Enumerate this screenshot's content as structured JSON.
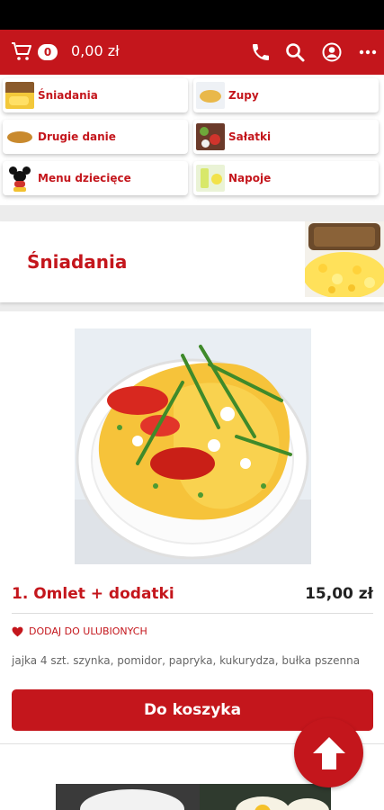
{
  "header": {
    "cart_count": "0",
    "cart_total": "0,00 zł",
    "icons": [
      "cart-icon",
      "phone-icon",
      "search-icon",
      "account-icon",
      "more-icon"
    ]
  },
  "categories": [
    {
      "label": "Śniadania",
      "icon": "breakfast-thumb"
    },
    {
      "label": "Zupy",
      "icon": "soup-thumb"
    },
    {
      "label": "Drugie danie",
      "icon": "main-course-thumb"
    },
    {
      "label": "Sałatki",
      "icon": "salad-thumb"
    },
    {
      "label": "Menu dziecięce",
      "icon": "mickey-mouse-thumb"
    },
    {
      "label": "Napoje",
      "icon": "drinks-thumb"
    }
  ],
  "section": {
    "title": "Śniadania"
  },
  "product": {
    "name": "1. Omlet + dodatki",
    "price": "15,00 zł",
    "favorite_label": "DODAJ DO ULUBIONYCH",
    "description": "jajka 4 szt. szynka, pomidor, papryka, kukurydza, bułka pszenna",
    "add_to_cart_label": "Do koszyka"
  },
  "colors": {
    "brand": "#c4161c",
    "background": "#ececec",
    "card": "#ffffff"
  }
}
